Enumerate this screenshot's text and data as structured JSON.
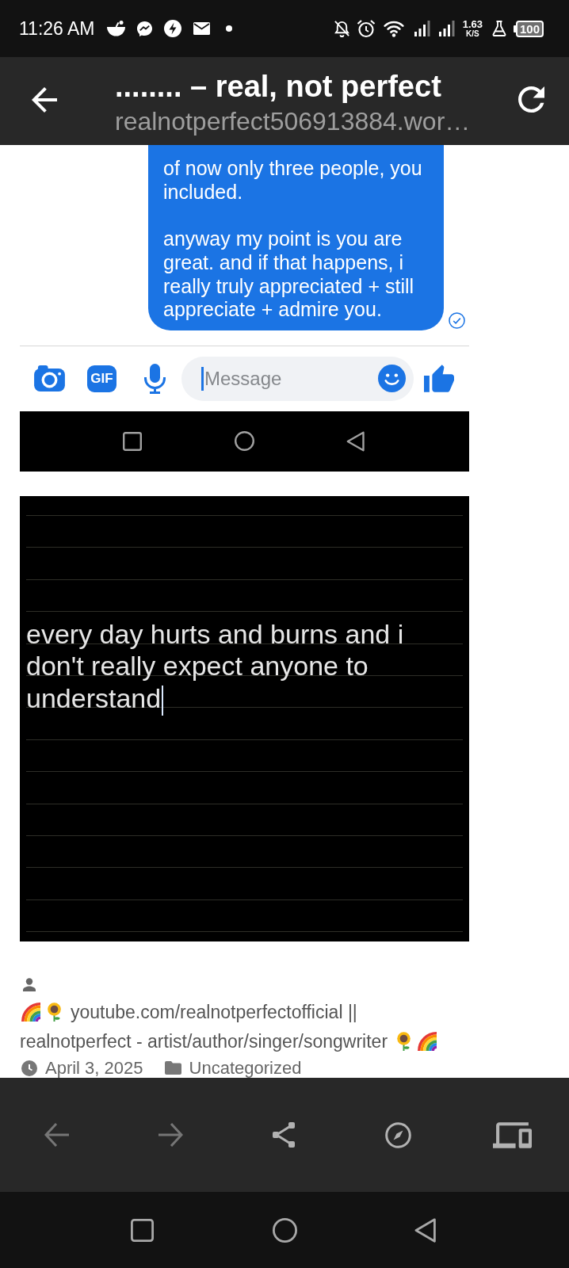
{
  "status_bar": {
    "time": "11:26 AM",
    "net_speed": "1.63",
    "net_speed_unit": "K/S",
    "battery": "100"
  },
  "header": {
    "title": "........ – real, not perfect",
    "url": "realnotperfect506913884.wor…"
  },
  "chat_screenshot": {
    "message": {
      "paragraphs": [
        "of now only three people, you included.",
        "anyway my point is you are great. and if that happens, i really truly appreciated + still appreciate + admire you."
      ]
    },
    "composer": {
      "gif_label": "GIF",
      "placeholder": "Message"
    }
  },
  "notes_screenshot": {
    "lines": [
      "every day hurts and burns and i",
      "don't really expect anyone to",
      "understand"
    ]
  },
  "post_meta": {
    "author_bio_lines": [
      "youtube.com/realnotperfectofficial ||",
      "realnotperfect - artist/author/singer/songwriter"
    ],
    "date": "April 3, 2025",
    "category": "Uncategorized"
  },
  "bottom_toolbar": [
    {
      "kind": "back",
      "disabled": true
    },
    {
      "kind": "forward",
      "disabled": true
    },
    {
      "kind": "share",
      "disabled": false
    },
    {
      "kind": "explore",
      "disabled": false
    },
    {
      "kind": "devices",
      "disabled": false
    }
  ]
}
